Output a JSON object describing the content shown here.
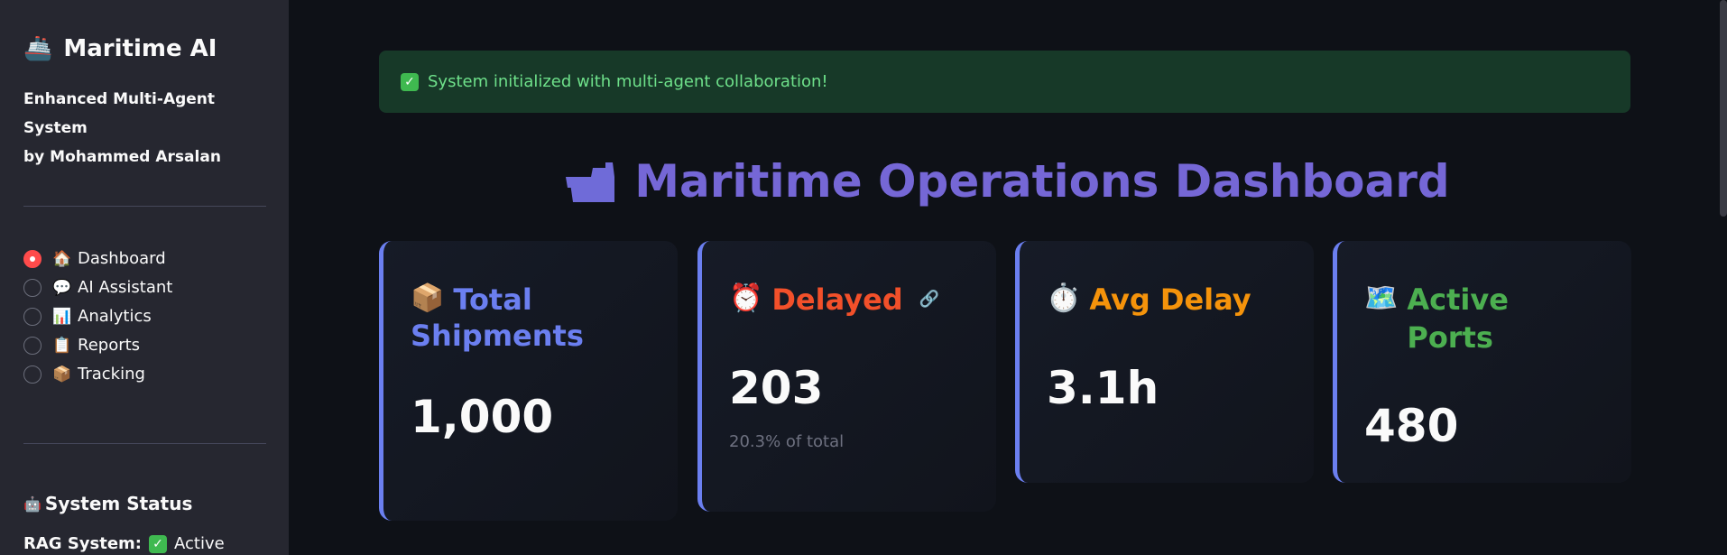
{
  "sidebar": {
    "brand": {
      "icon": "ship-icon",
      "title": "Maritime AI"
    },
    "subtitle_line1": "Enhanced Multi-Agent System",
    "subtitle_line2": "by Mohammed Arsalan",
    "nav": [
      {
        "emoji": "🏠",
        "label": "Dashboard",
        "selected": true
      },
      {
        "emoji": "💬",
        "label": "AI Assistant",
        "selected": false
      },
      {
        "emoji": "📊",
        "label": "Analytics",
        "selected": false
      },
      {
        "emoji": "📋",
        "label": "Reports",
        "selected": false
      },
      {
        "emoji": "📦",
        "label": "Tracking",
        "selected": false
      }
    ],
    "status_title": "System Status",
    "rag_label": "RAG System:",
    "rag_value": "Active"
  },
  "main": {
    "alert": "System initialized with multi-agent collaboration!",
    "title": "Maritime Operations Dashboard",
    "cards": [
      {
        "emoji": "📦",
        "label_line1": "Total",
        "label_line2": "Shipments",
        "value": "1,000",
        "color": "#6b7ff0"
      },
      {
        "emoji": "⏰",
        "label": "Delayed",
        "value": "203",
        "sub": "20.3% of total",
        "color": "#f2502a"
      },
      {
        "emoji": "⏱️",
        "label": "Avg Delay",
        "value": "3.1h",
        "color": "#f5930b"
      },
      {
        "emoji": "🗺️",
        "label": "Active Ports",
        "value": "480",
        "color": "#4caf50"
      }
    ]
  }
}
